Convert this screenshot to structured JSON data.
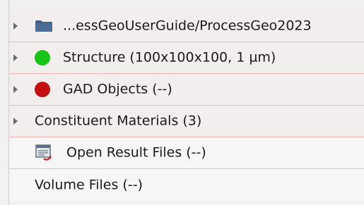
{
  "tree": {
    "items": [
      {
        "label": "...essGeoUserGuide/ProcessGeo2023",
        "icon": "folder-icon",
        "expandable": true
      },
      {
        "label": "Structure (100x100x100, 1 µm)",
        "icon": "green-dot-icon",
        "color": "#19c419",
        "expandable": true
      },
      {
        "label": "GAD Objects (--)",
        "icon": "red-dot-icon",
        "color": "#c40f0f",
        "expandable": true
      },
      {
        "label": "Constituent Materials (3)",
        "expandable": true
      },
      {
        "label": "Open Result Files (--)",
        "icon": "result-file-icon",
        "expandable": false
      },
      {
        "label": "Volume Files (--)",
        "expandable": false
      }
    ]
  },
  "colors": {
    "folder": "#3f5f86",
    "separator": "#f2b6b6",
    "background": "#f3eeee"
  }
}
